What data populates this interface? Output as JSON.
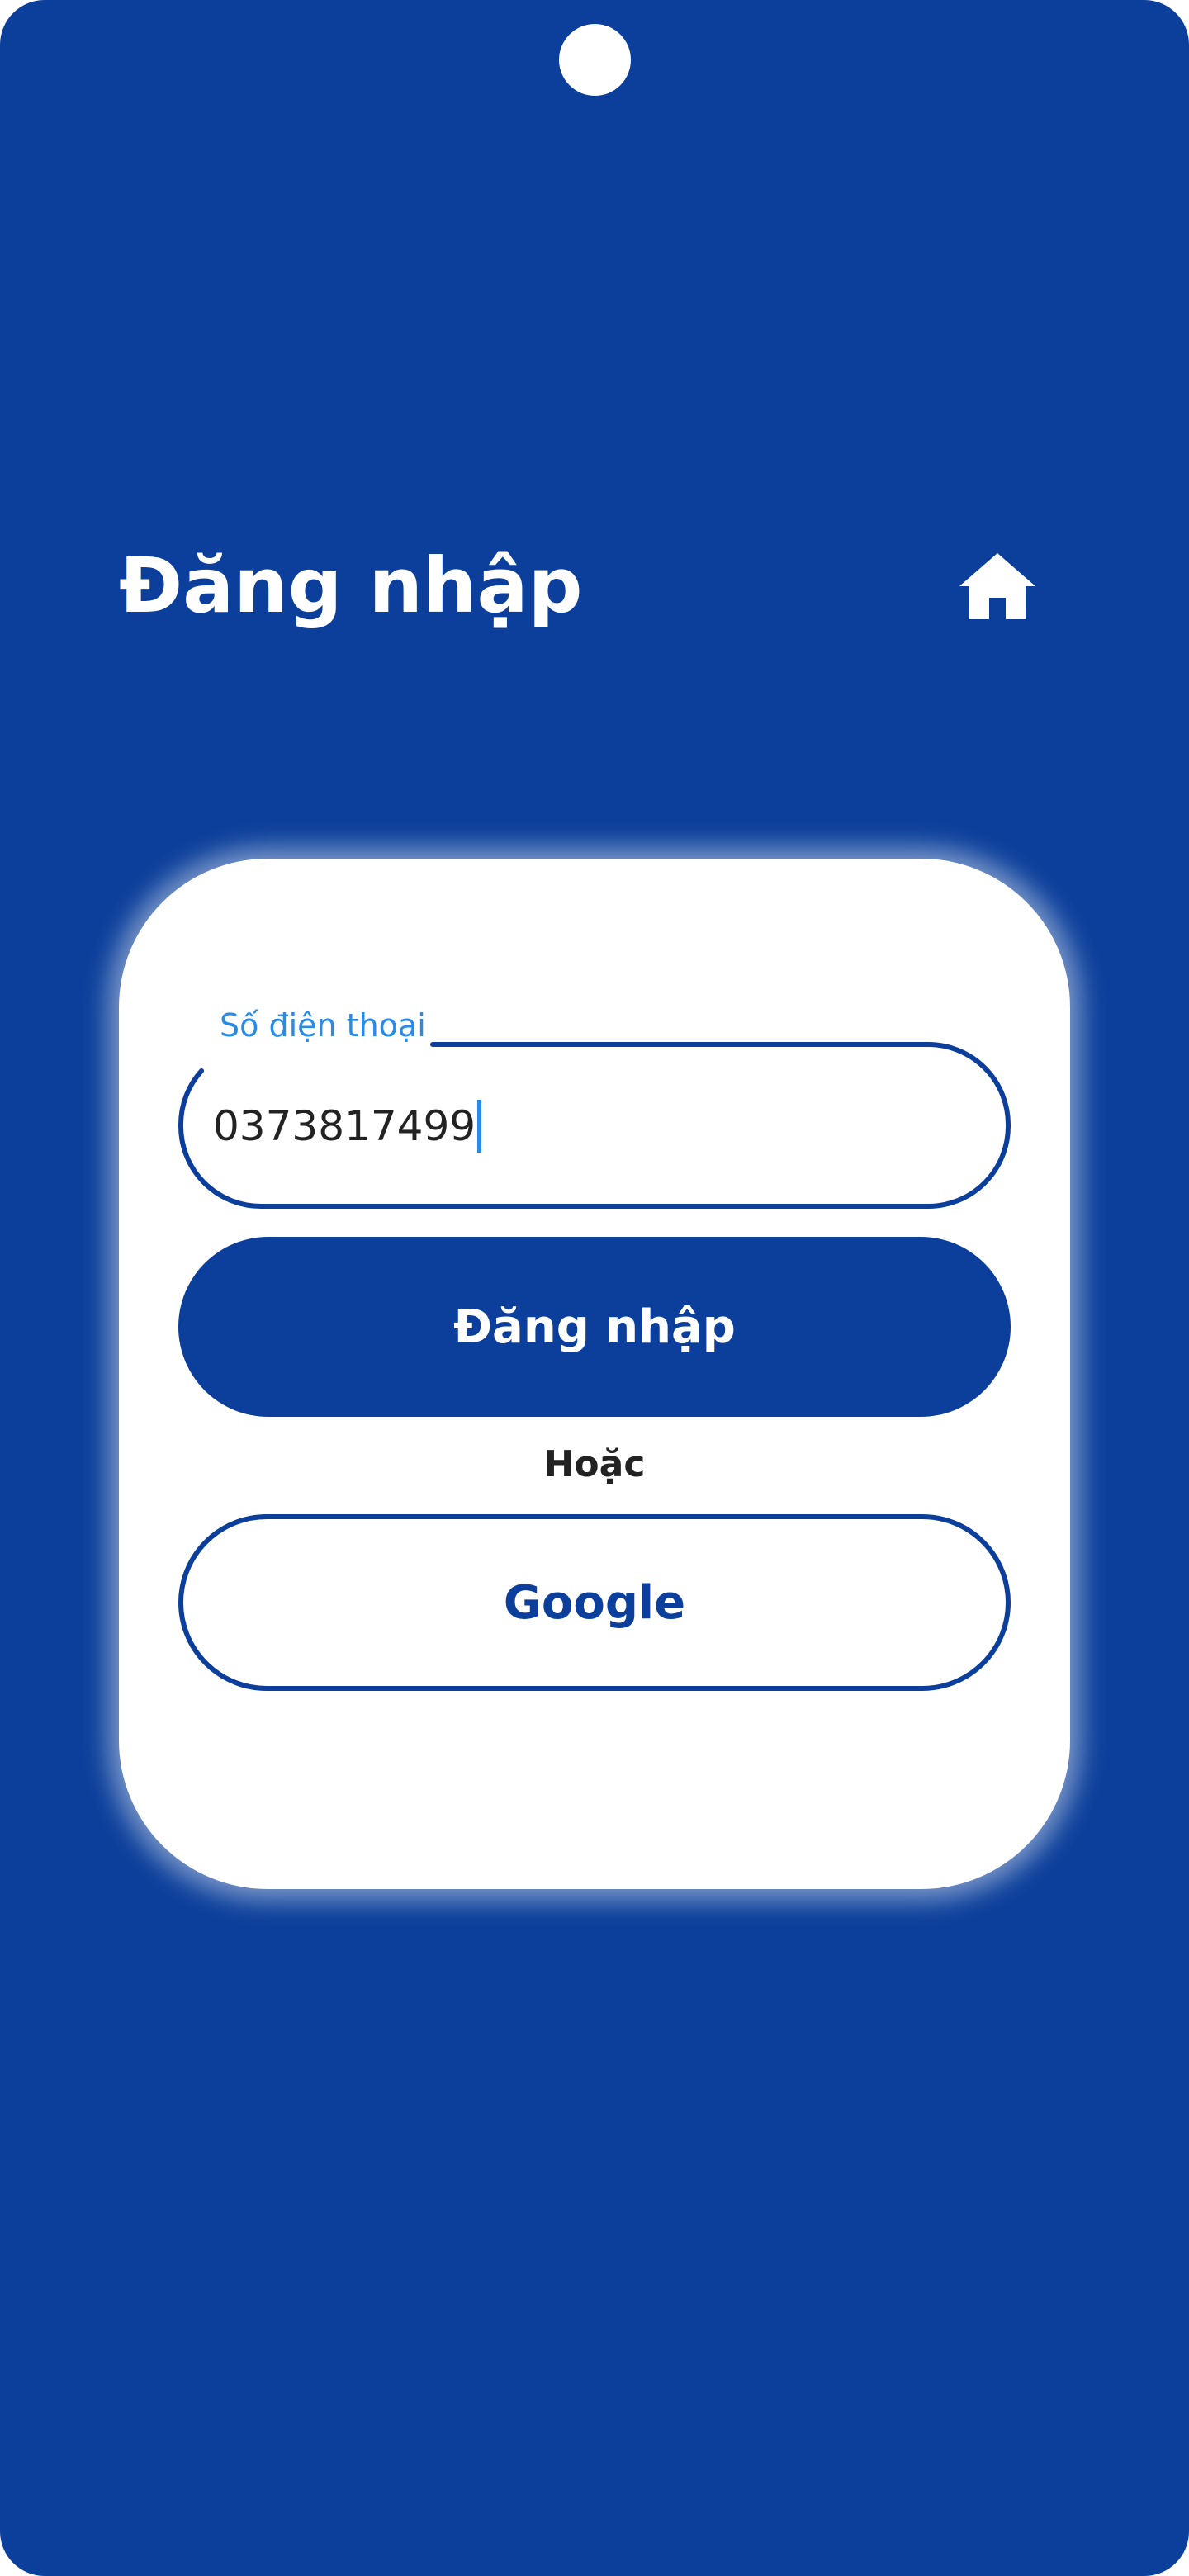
{
  "header": {
    "title": "Đăng nhập",
    "home_icon": "home-icon"
  },
  "login_form": {
    "phone_field": {
      "label": "Số điện thoại",
      "value": "0373817499"
    },
    "login_button_label": "Đăng nhập",
    "divider_text": "Hoặc",
    "google_button_label": "Google"
  },
  "colors": {
    "background": "#0b3f9b",
    "primary": "#0b3f9b",
    "label_accent": "#2a8be6",
    "card": "#ffffff",
    "text_dark": "#222222"
  }
}
